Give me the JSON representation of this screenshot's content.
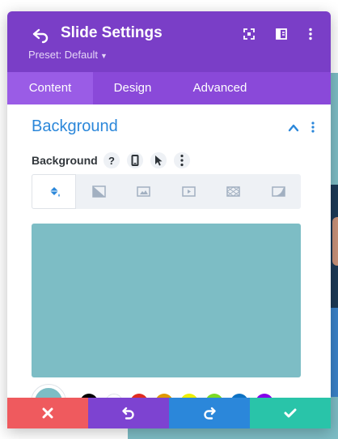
{
  "header": {
    "title": "Slide Settings",
    "preset": "Preset: Default",
    "bg_color": "#7a3ec7",
    "icons": [
      "back-icon",
      "focus-icon",
      "sidebar-icon",
      "more-icon"
    ]
  },
  "tabs": [
    {
      "label": "Content",
      "active": true
    },
    {
      "label": "Design",
      "active": false
    },
    {
      "label": "Advanced",
      "active": false
    }
  ],
  "section": {
    "title": "Background",
    "field_label": "Background",
    "field_icons": [
      "help-icon",
      "mobile-icon",
      "hover-icon",
      "more-icon"
    ],
    "background_types": [
      {
        "name": "color",
        "icon": "paint-bucket-icon",
        "active": true
      },
      {
        "name": "gradient",
        "icon": "gradient-icon",
        "active": false
      },
      {
        "name": "image",
        "icon": "image-icon",
        "active": false
      },
      {
        "name": "video",
        "icon": "video-icon",
        "active": false
      },
      {
        "name": "pattern",
        "icon": "pattern-icon",
        "active": false
      },
      {
        "name": "mask",
        "icon": "mask-icon",
        "active": false
      }
    ],
    "selected_color": "#7dbdc5",
    "swatches": [
      "#000000",
      "#ffffff",
      "#e02b20",
      "#e09900",
      "#edf000",
      "#7cda24",
      "#0c71c3",
      "#8300e9"
    ]
  },
  "footer": {
    "buttons": [
      "discard",
      "undo",
      "redo",
      "save"
    ],
    "colors": {
      "discard": "#ef5a5e",
      "undo": "#7d43d1",
      "redo": "#2b87da",
      "save": "#29c4a9"
    }
  }
}
